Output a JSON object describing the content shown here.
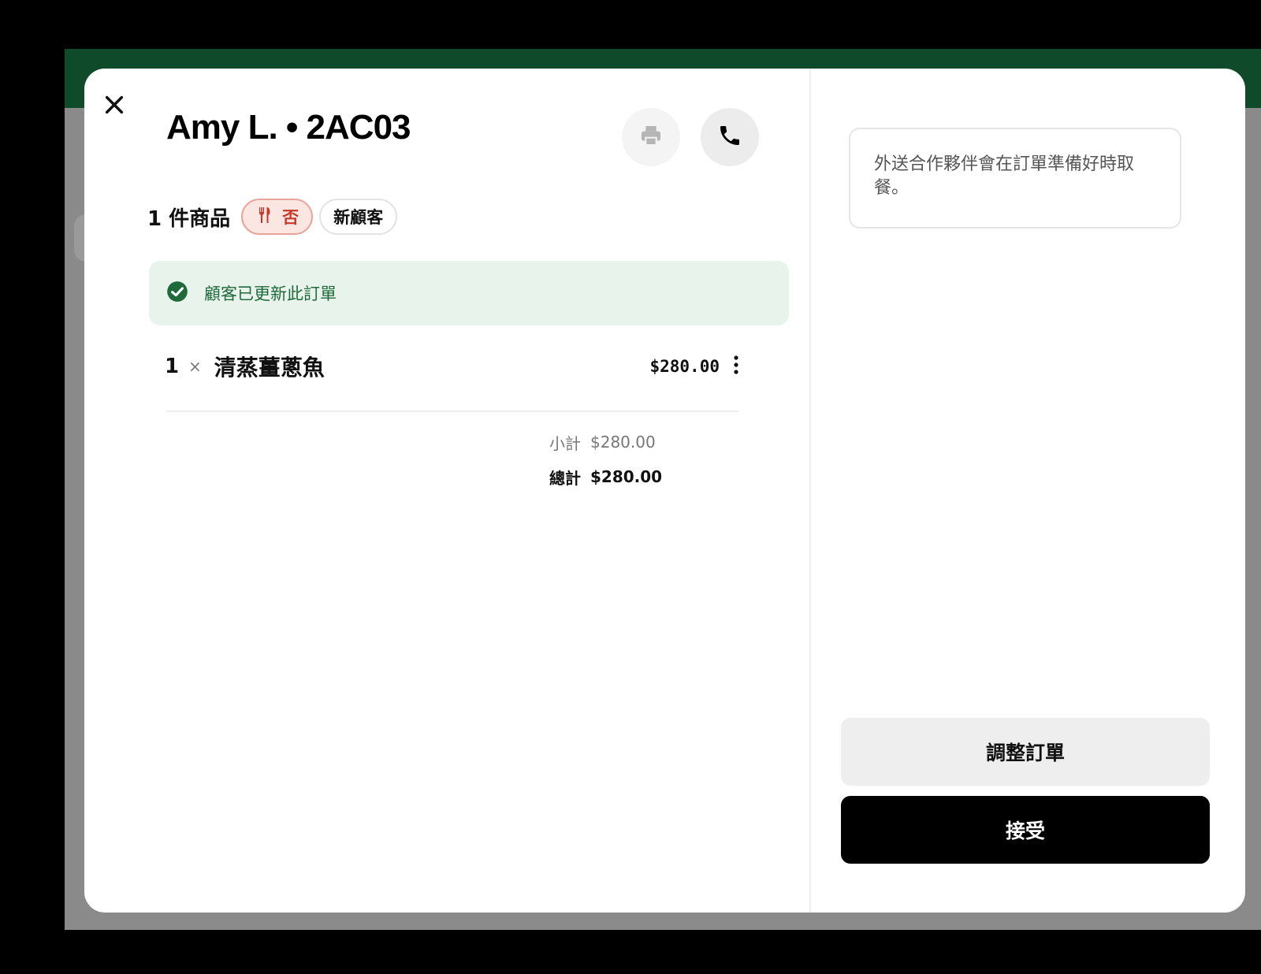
{
  "order": {
    "title": "Amy L. • 2AC03",
    "item_count": "1 件商品",
    "tags": {
      "utensils": "否",
      "new_customer": "新顧客"
    },
    "notice": "顧客已更新此訂單",
    "items": [
      {
        "qty": "1",
        "sep": "×",
        "name": "清蒸薑蔥魚",
        "price": "$280.00"
      }
    ],
    "subtotal_label": "小計",
    "subtotal_value": "$280.00",
    "total_label": "總計",
    "total_value": "$280.00"
  },
  "side": {
    "info": "外送合作夥伴會在訂單準備好時取餐。",
    "adjust_label": "調整訂單",
    "accept_label": "接受"
  },
  "icons": {
    "close": "close-icon",
    "print": "printer-icon",
    "phone": "phone-icon",
    "utensils": "utensils-icon",
    "check": "check-circle-icon",
    "more": "more-vertical-icon"
  },
  "colors": {
    "header_green": "#0f4a2a",
    "notice_bg": "#e8f3ec",
    "notice_text": "#1f6a3b",
    "tag_red": "#c6392a",
    "accept_bg": "#000000"
  }
}
